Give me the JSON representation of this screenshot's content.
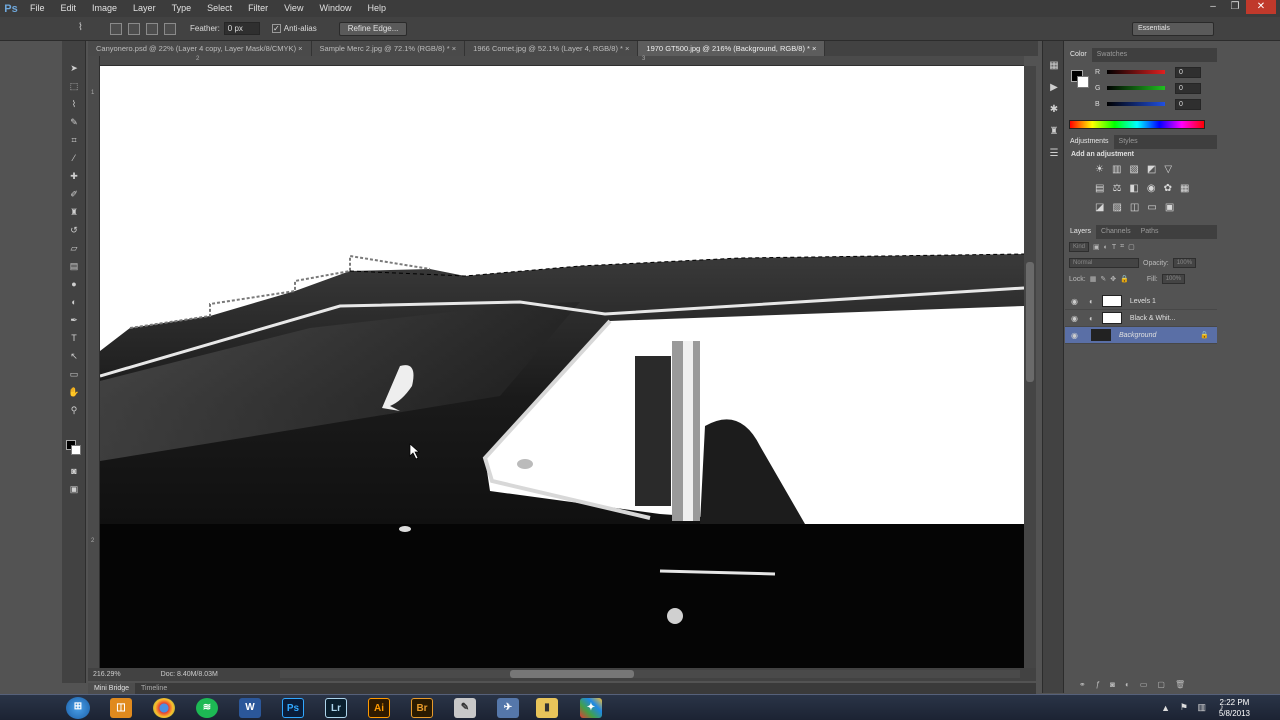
{
  "app": {
    "logo": "Ps",
    "menu": [
      "File",
      "Edit",
      "Image",
      "Layer",
      "Type",
      "Select",
      "Filter",
      "View",
      "Window",
      "Help"
    ],
    "window_controls": [
      "–",
      "❐",
      "✕"
    ]
  },
  "options_bar": {
    "feather_label": "Feather:",
    "feather_value": "0 px",
    "antialias_label": "Anti-alias",
    "refine_edge_label": "Refine Edge...",
    "workspace": "Essentials"
  },
  "document_tabs": [
    "Canyonero.psd @ 22% (Layer 4 copy, Layer Mask/8/CMYK)",
    "Sample Merc 2.jpg @ 72.1% (RGB/8) *",
    "1966 Comet.jpg @ 52.1% (Layer 4, RGB/8) *",
    "1970 GT500.jpg @ 216% (Background, RGB/8) *"
  ],
  "rulers": {
    "top": [
      "2",
      "3"
    ],
    "left": [
      "1",
      "2"
    ]
  },
  "status_bar": {
    "zoom": "216.29%",
    "doc_size": "Doc: 8.40M/8.03M"
  },
  "mini_bridge": {
    "tabs": [
      "Mini Bridge",
      "Timeline"
    ]
  },
  "color_panel": {
    "tabs": [
      "Color",
      "Swatches"
    ],
    "channels": [
      {
        "label": "R",
        "value": "0",
        "color": "#e02020"
      },
      {
        "label": "G",
        "value": "0",
        "color": "#20c020"
      },
      {
        "label": "B",
        "value": "0",
        "color": "#2050e0"
      }
    ],
    "foreground": "#000000",
    "background": "#ffffff"
  },
  "adjustments_panel": {
    "tabs": [
      "Adjustments",
      "Styles"
    ],
    "title": "Add an adjustment"
  },
  "layers_panel": {
    "tabs": [
      "Layers",
      "Channels",
      "Paths"
    ],
    "kind": "Kind",
    "blend_mode": "Normal",
    "opacity_label": "Opacity:",
    "opacity_value": "100%",
    "lock_label": "Lock:",
    "fill_label": "Fill:",
    "fill_value": "100%",
    "layers": [
      {
        "name": "Levels 1",
        "selected": false
      },
      {
        "name": "Black & Whit...",
        "selected": false
      },
      {
        "name": "Background",
        "selected": true
      }
    ]
  },
  "taskbar": {
    "time": "2:22 PM",
    "date": "5/8/2013",
    "apps": [
      "Ps",
      "Lr",
      "Ai",
      "Br"
    ]
  }
}
